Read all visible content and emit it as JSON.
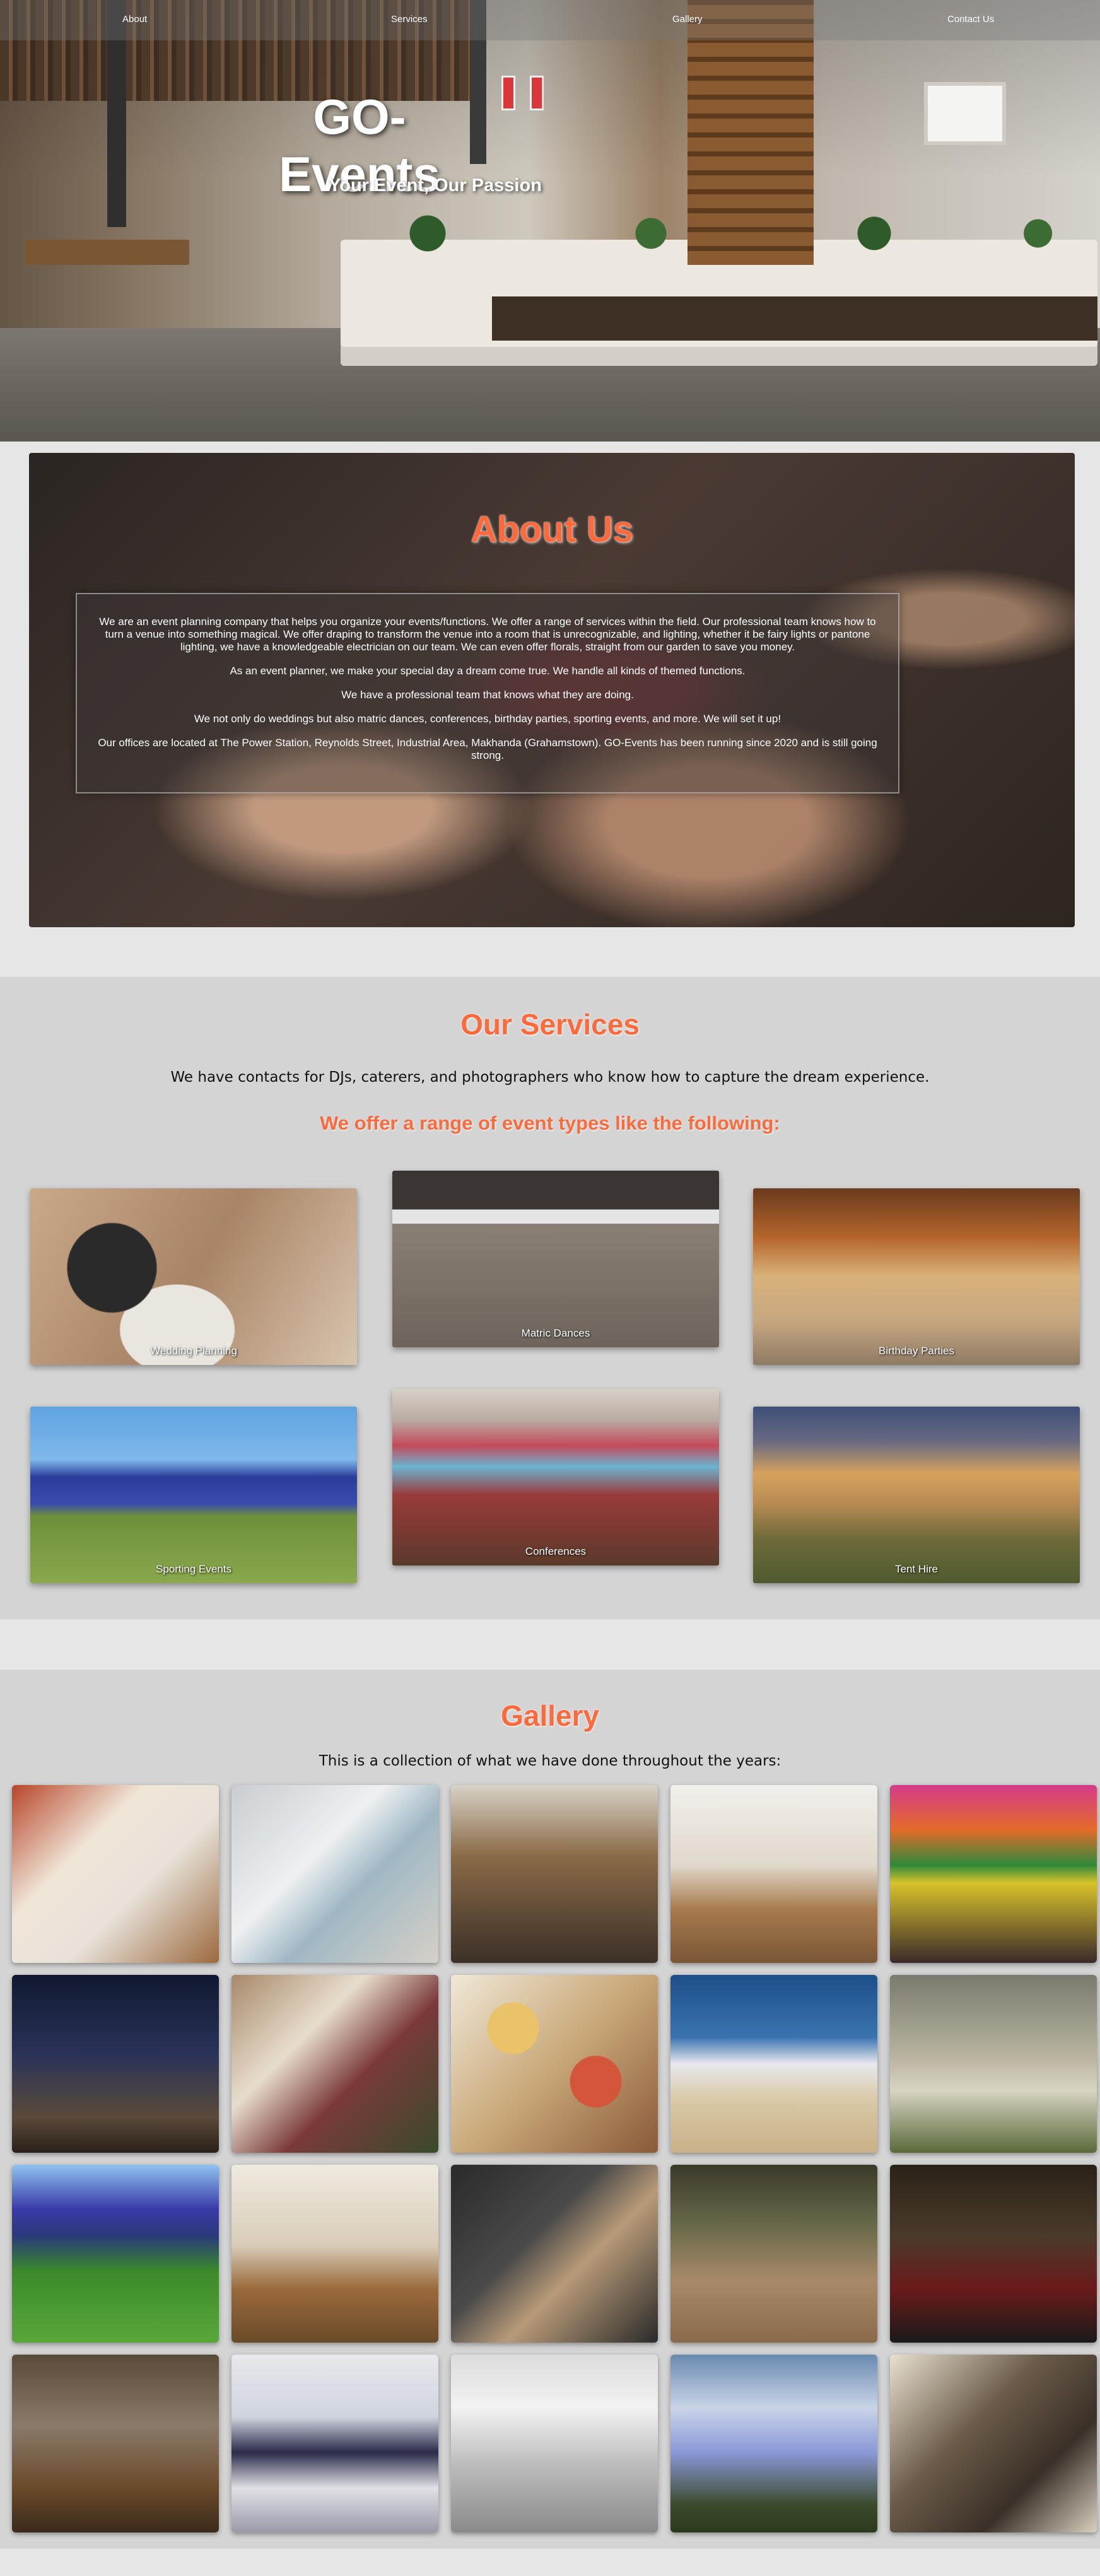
{
  "nav": {
    "links": [
      "About",
      "Services",
      "Gallery",
      "Contact Us"
    ]
  },
  "hero": {
    "title": "GO-Events",
    "subtitle": "Your Event, Our Passion"
  },
  "about": {
    "title": "About Us",
    "paragraphs": [
      "We are an event planning company that helps you organize your events/functions. We offer a range of services within the field. Our professional team knows how to turn a venue into something magical. We offer draping to transform the venue into a room that is unrecognizable, and lighting, whether it be fairy lights or pantone lighting, we have a knowledgeable electrician on our team. We can even offer florals, straight from our garden to save you money.",
      "As an event planner, we make your special day a dream come true. We handle all kinds of themed functions.",
      "We have a professional team that knows what they are doing.",
      "We not only do weddings but also matric dances, conferences, birthday parties, sporting events, and more. We will set it up!",
      "Our offices are located at The Power Station, Reynolds Street, Industrial Area, Makhanda (Grahamstown). GO-Events has been running since 2020 and is still going strong."
    ]
  },
  "services": {
    "title": "Our Services",
    "intro": "We have contacts for DJs, caterers, and photographers who know how to capture the dream experience.",
    "subtitle": "We offer a range of event types like the following:",
    "cards": [
      {
        "label": "Wedding Planning"
      },
      {
        "label": "Matric Dances"
      },
      {
        "label": "Birthday Parties"
      },
      {
        "label": "Sporting Events"
      },
      {
        "label": "Conferences"
      },
      {
        "label": "Tent Hire"
      }
    ]
  },
  "gallery": {
    "title": "Gallery",
    "intro": "This is a collection of what we have done throughout the years:"
  }
}
